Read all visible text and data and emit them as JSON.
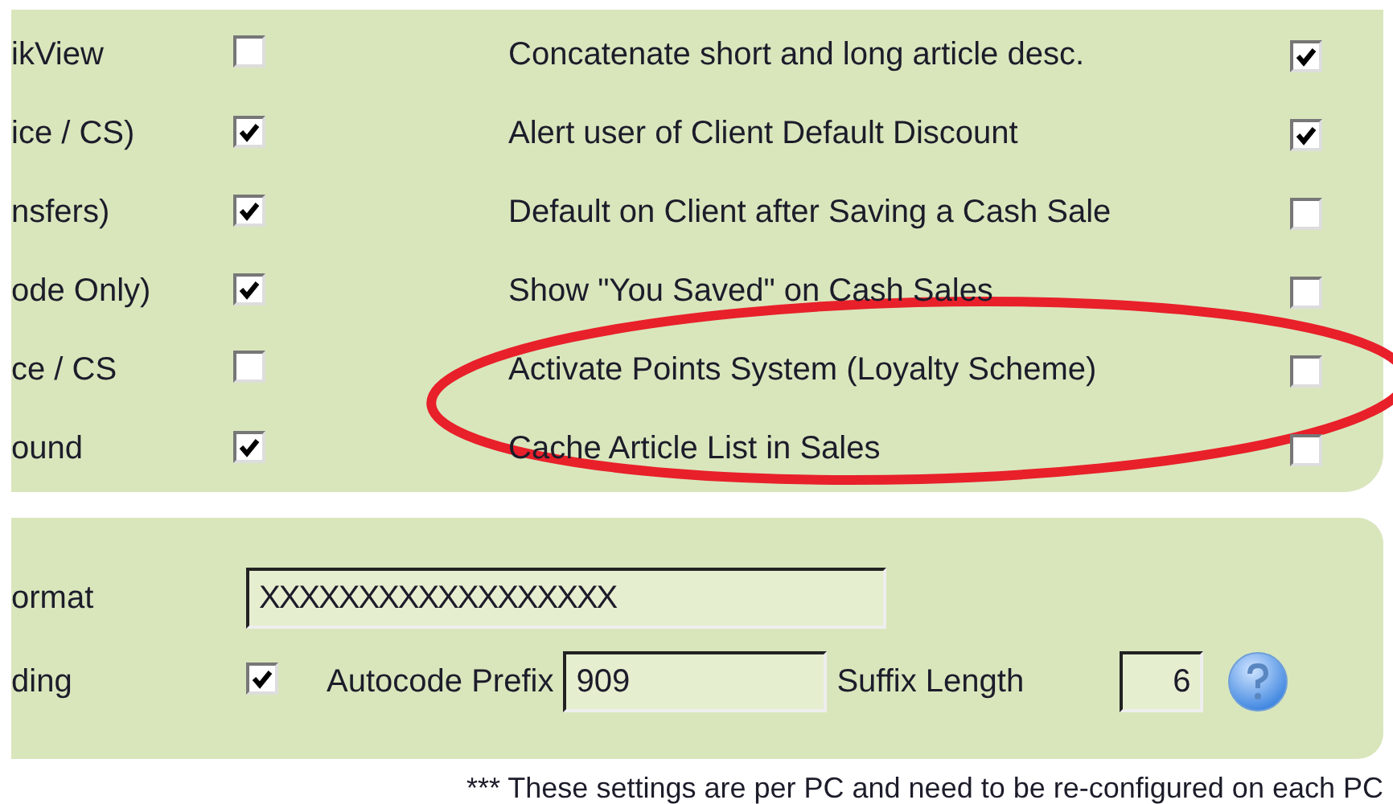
{
  "options_left": [
    {
      "label": "ikView",
      "checked": false
    },
    {
      "label": "ice / CS)",
      "checked": true
    },
    {
      "label": "nsfers)",
      "checked": true
    },
    {
      "label": "ode Only)",
      "checked": true
    },
    {
      "label": "ce / CS",
      "checked": false
    },
    {
      "label": "ound",
      "checked": true
    }
  ],
  "options_right": [
    {
      "label": "Concatenate short and long article desc.",
      "checked": true
    },
    {
      "label": "Alert user of Client Default Discount",
      "checked": true
    },
    {
      "label": "Default on Client after Saving a Cash Sale",
      "checked": false
    },
    {
      "label": "Show \"You Saved\" on Cash Sales",
      "checked": false
    },
    {
      "label": "Activate Points System (Loyalty Scheme)",
      "checked": false
    },
    {
      "label": "Cache Article List in Sales",
      "checked": false
    }
  ],
  "format": {
    "label": "ormat",
    "value": "XXXXXXXXXXXXXXXXXX"
  },
  "autocoding": {
    "label": "ding",
    "checked": true,
    "prefix_label": "Autocode Prefix",
    "prefix": "909",
    "suffix_label": "Suffix Length",
    "suffix": "6"
  },
  "note": "*** These settings are per PC and need to be re-configured on each PC"
}
